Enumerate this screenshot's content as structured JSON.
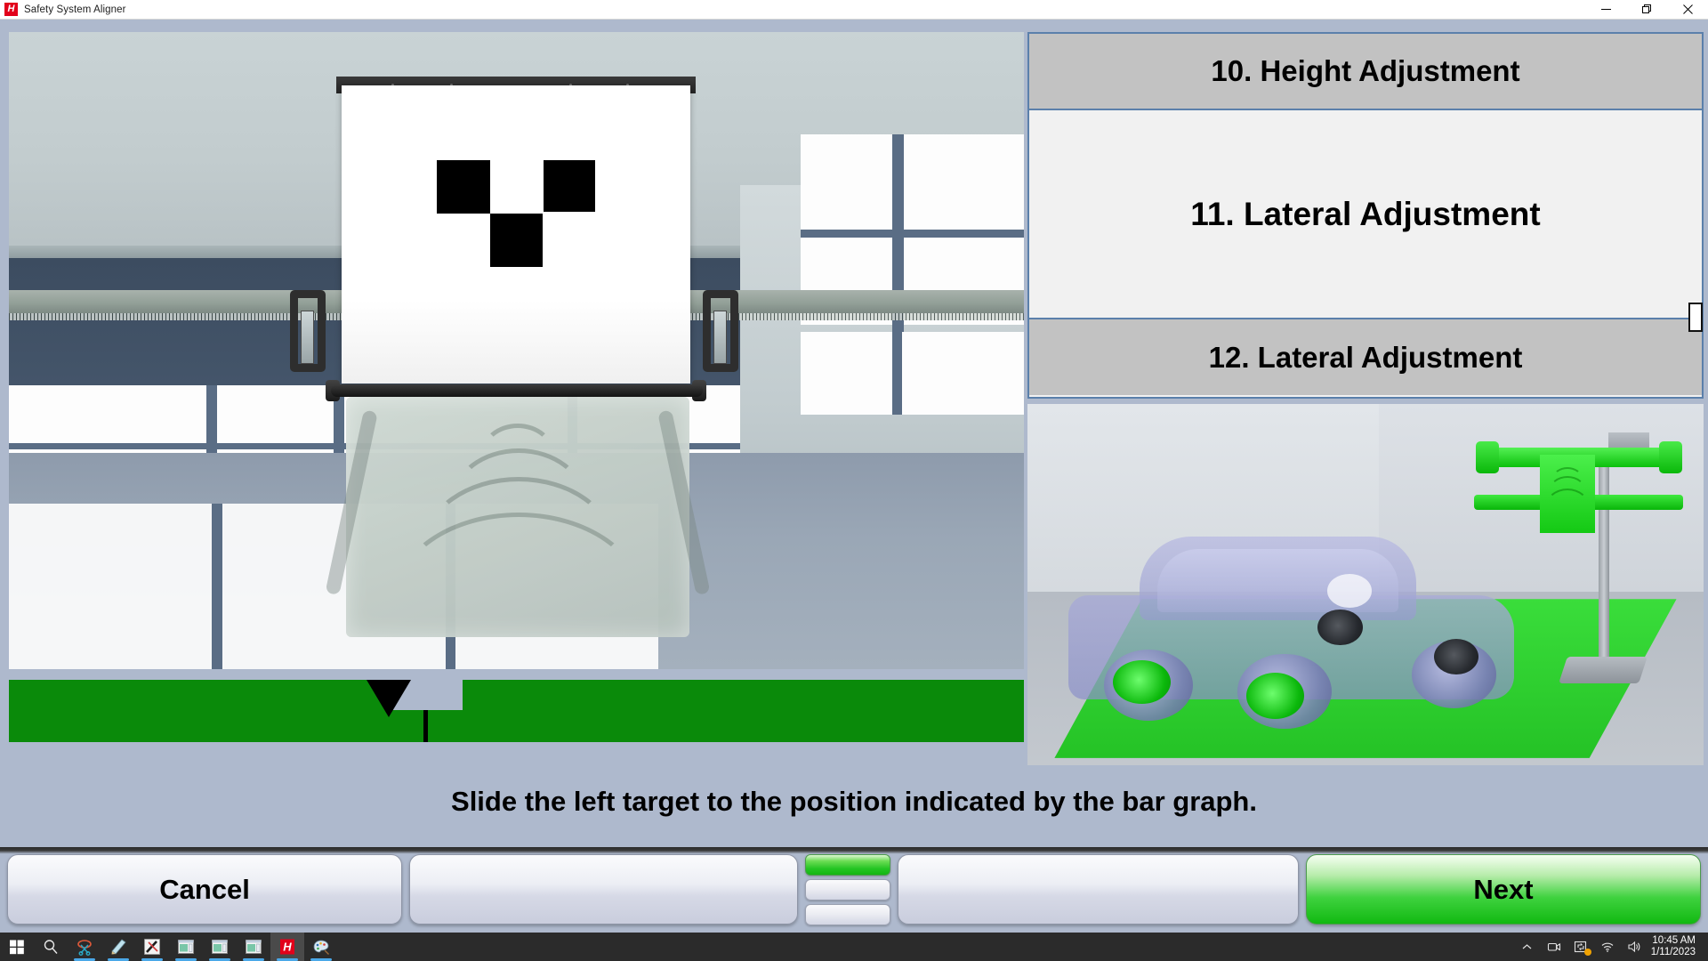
{
  "window": {
    "title": "Safety System Aligner",
    "logo_icon": "h-logo-icon",
    "controls": {
      "minimize": "minimize-icon",
      "restore": "restore-icon",
      "close": "close-icon"
    }
  },
  "steps": [
    {
      "label": "10. Height Adjustment",
      "state": "inactive"
    },
    {
      "label": "11. Lateral Adjustment",
      "state": "active"
    },
    {
      "label": "12. Lateral Adjustment",
      "state": "inactive"
    }
  ],
  "bar_graph": {
    "fill_color": "#0a8a0a",
    "marker_icon": "down-triangle-marker",
    "marker_position_pct": 37.5,
    "center_line_position_pct": 41.2,
    "notch_position_pct": 37.9
  },
  "instruction": {
    "text": "Slide the left target to the position indicated by the bar graph."
  },
  "buttons": {
    "cancel": "Cancel",
    "blank1": "",
    "blank2": "",
    "next": "Next"
  },
  "segment_indicator": {
    "segments": [
      {
        "state": "on"
      },
      {
        "state": "off"
      },
      {
        "state": "off"
      }
    ]
  },
  "scene": {
    "camera_view_label": "",
    "target_squares": 3
  },
  "taskbar": {
    "items": [
      {
        "name": "start-button",
        "icon": "windows-logo-icon"
      },
      {
        "name": "search-button",
        "icon": "search-icon"
      },
      {
        "name": "snipping-tool",
        "icon": "scissors-icon"
      },
      {
        "name": "notepad",
        "icon": "notepad-icon"
      },
      {
        "name": "tool-app",
        "icon": "hammer-icon"
      },
      {
        "name": "window-app-1",
        "icon": "window-icon"
      },
      {
        "name": "window-app-2",
        "icon": "window-icon"
      },
      {
        "name": "window-app-3",
        "icon": "window-icon"
      },
      {
        "name": "safety-system-aligner",
        "icon": "h-logo-icon"
      },
      {
        "name": "paint",
        "icon": "palette-icon"
      }
    ],
    "tray": [
      {
        "name": "show-hidden-icons",
        "icon": "chevron-up-icon"
      },
      {
        "name": "camera-status",
        "icon": "camera-icon"
      },
      {
        "name": "onedrive-sync",
        "icon": "sync-icon"
      },
      {
        "name": "network",
        "icon": "wifi-icon"
      },
      {
        "name": "volume",
        "icon": "speaker-icon"
      }
    ],
    "clock": {
      "time": "10:45 AM",
      "date": "1/11/2023"
    }
  }
}
